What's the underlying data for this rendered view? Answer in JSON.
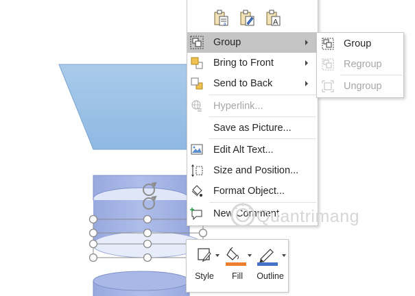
{
  "context_menu": {
    "paste_options": [
      {
        "icon": "paste-keep-source-formatting-icon"
      },
      {
        "icon": "paste-use-destination-theme-icon"
      },
      {
        "icon": "paste-keep-text-only-icon"
      }
    ],
    "items": [
      {
        "label": "Group",
        "icon": "group-icon",
        "has_submenu": true,
        "highlighted": true,
        "enabled": true
      },
      {
        "label": "Bring to Front",
        "icon": "bring-to-front-icon",
        "has_submenu": true,
        "enabled": true
      },
      {
        "label": "Send to Back",
        "icon": "send-to-back-icon",
        "has_submenu": true,
        "enabled": true
      },
      {
        "label": "Hyperlink...",
        "icon": "hyperlink-icon",
        "enabled": false
      },
      {
        "label": "Save as Picture...",
        "icon": "",
        "enabled": true
      },
      {
        "label": "Edit Alt Text...",
        "icon": "alt-text-icon",
        "enabled": true
      },
      {
        "label": "Size and Position...",
        "icon": "size-position-icon",
        "enabled": true
      },
      {
        "label": "Format Object...",
        "icon": "format-object-icon",
        "enabled": true
      },
      {
        "label": "New Comment",
        "icon": "new-comment-icon",
        "enabled": true
      }
    ]
  },
  "group_submenu": {
    "items": [
      {
        "label": "Group",
        "icon": "group-icon",
        "enabled": true
      },
      {
        "label": "Regroup",
        "icon": "regroup-icon",
        "enabled": false
      },
      {
        "label": "Ungroup",
        "icon": "ungroup-icon",
        "enabled": false
      }
    ]
  },
  "mini_toolbar": {
    "style_label": "Style",
    "fill_label": "Fill",
    "outline_label": "Outline",
    "fill_color": "#ed7d31",
    "outline_color": "#4472c4"
  },
  "watermark": {
    "text": "Quantrimang"
  },
  "colors": {
    "shape_fill": "#a4b4e4",
    "shape_top": "#dde4f6",
    "trapezoid_fill": "#9dc3e6",
    "menu_highlight": "#c5c5c5",
    "disabled_text": "#a6a6a6"
  }
}
